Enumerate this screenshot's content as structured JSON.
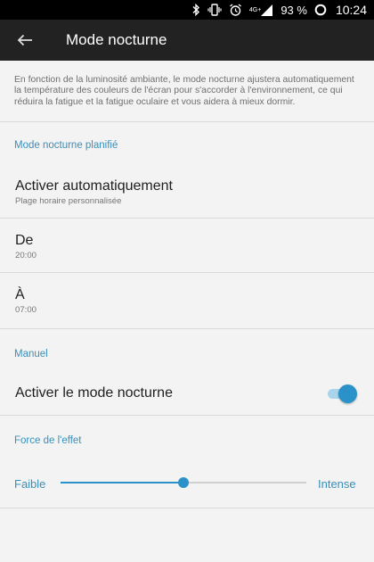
{
  "status_bar": {
    "network_tag": "4G+",
    "battery_percent": "93 %",
    "time": "10:24"
  },
  "app_bar": {
    "title": "Mode nocturne",
    "back_icon": "arrow-back-icon"
  },
  "description": "En fonction de la luminosité ambiante, le mode nocturne ajustera automatiquement la température des couleurs de l'écran pour s'accorder à l'environnement, ce qui réduira la fatigue et la fatigue oculaire et vous aidera à mieux dormir.",
  "scheduled": {
    "header": "Mode nocturne planifié",
    "auto": {
      "title": "Activer automatiquement",
      "subtitle": "Plage horaire personnalisée"
    },
    "from": {
      "title": "De",
      "value": "20:00"
    },
    "to": {
      "title": "À",
      "value": "07:00"
    }
  },
  "manual": {
    "header": "Manuel",
    "toggle_label": "Activer le mode nocturne",
    "toggle_on": true
  },
  "strength": {
    "header": "Force de l'effet",
    "min_label": "Faible",
    "max_label": "Intense",
    "level_fraction": 0.5
  },
  "colors": {
    "accent": "#2a92c9",
    "section_header": "#3a8fb9",
    "app_bar": "#222222",
    "background": "#f3f3f3"
  }
}
